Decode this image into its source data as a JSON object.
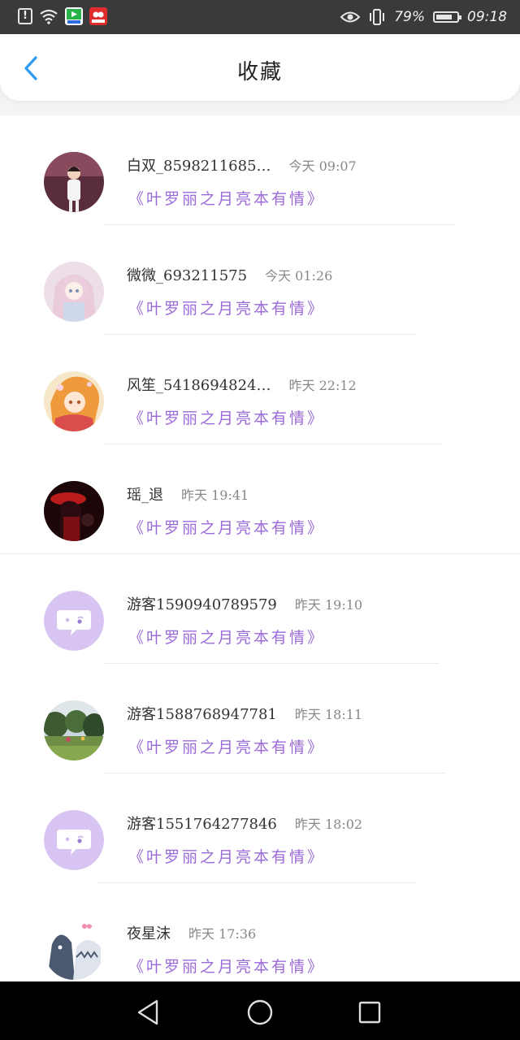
{
  "status_bar": {
    "battery_percent": "79%",
    "time": "09:18",
    "battery_level": 0.79
  },
  "header": {
    "title": "收藏"
  },
  "favorites": [
    {
      "name": "白双_8598211685…",
      "time": "今天 09:07",
      "book": "《叶罗丽之月亮本有情》",
      "avatar": "photo-girl"
    },
    {
      "name": "微微_693211575",
      "time": "今天 01:26",
      "book": "《叶罗丽之月亮本有情》",
      "avatar": "anime-pink"
    },
    {
      "name": "风笙_5418694824…",
      "time": "昨天 22:12",
      "book": "《叶罗丽之月亮本有情》",
      "avatar": "anime-orange"
    },
    {
      "name": "瑶_退",
      "time": "昨天 19:41",
      "book": "《叶罗丽之月亮本有情》",
      "avatar": "anime-red"
    },
    {
      "name": "游客1590940789579",
      "time": "昨天 19:10",
      "book": "《叶罗丽之月亮本有情》",
      "avatar": "default-chat"
    },
    {
      "name": "游客1588768947781",
      "time": "昨天 18:11",
      "book": "《叶罗丽之月亮本有情》",
      "avatar": "photo-garden"
    },
    {
      "name": "游客1551764277846",
      "time": "昨天 18:02",
      "book": "《叶罗丽之月亮本有情》",
      "avatar": "default-chat"
    },
    {
      "name": "夜星沫",
      "time": "昨天 17:36",
      "book": "《叶罗丽之月亮本有情》",
      "avatar": "cartoon-shark"
    }
  ],
  "colors": {
    "accent_blue": "#2e9bf0",
    "book_purple": "#9b6ad9",
    "default_avatar": "#d8c4f3"
  }
}
